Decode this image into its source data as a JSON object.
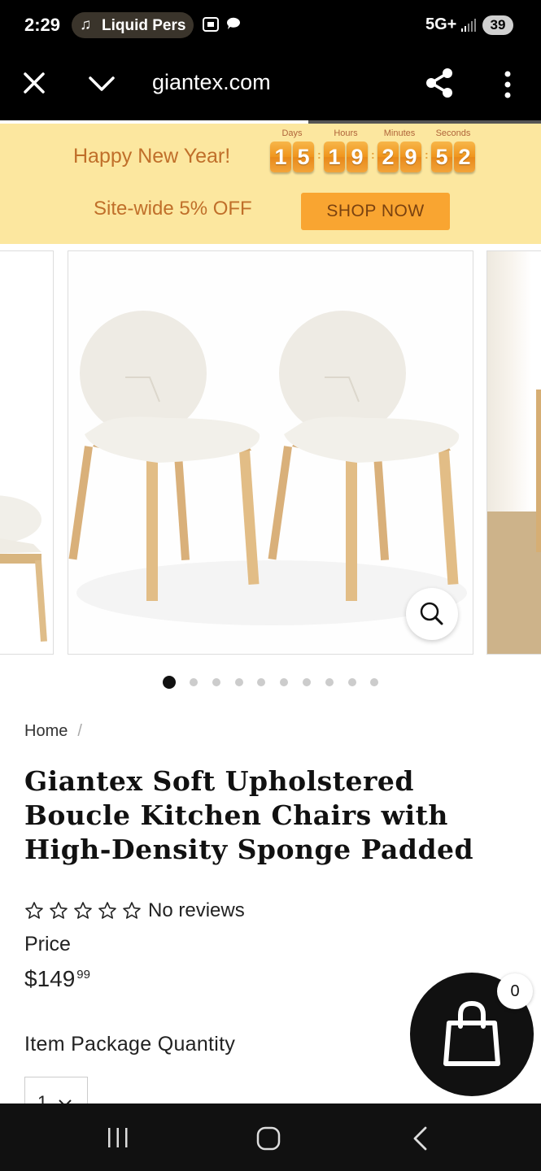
{
  "status_bar": {
    "time": "2:29",
    "media_label": "Liquid Pers",
    "network": "5G+",
    "battery": "39"
  },
  "browser": {
    "url": "giantex.com",
    "load_progress": 0.57
  },
  "promo": {
    "title": "Happy New Year!",
    "countdown": [
      {
        "label": "Days",
        "digits": [
          "1",
          "5"
        ]
      },
      {
        "label": "Hours",
        "digits": [
          "1",
          "9"
        ]
      },
      {
        "label": "Minutes",
        "digits": [
          "2",
          "9"
        ]
      },
      {
        "label": "Seconds",
        "digits": [
          "5",
          "2"
        ]
      }
    ],
    "subtitle": "Site-wide 5% OFF",
    "cta": "SHOP NOW",
    "colors": {
      "background": "#fce79f",
      "text": "#c06f2a",
      "button": "#f9a531"
    }
  },
  "gallery": {
    "dot_count": 10,
    "active_index": 0
  },
  "product": {
    "breadcrumb_home": "Home",
    "breadcrumb_sep": "/",
    "title": "Giantex Soft Upholstered Boucle Kitchen Chairs with High-Density Sponge Padded",
    "rating_stars": 0,
    "reviews_text": "No reviews",
    "price_label": "Price",
    "price_whole": "$149",
    "price_cents": "99",
    "quantity_label": "Item Package Quantity",
    "quantity_value": "1"
  },
  "cart": {
    "count": "0"
  },
  "icons": {
    "close": "close-icon",
    "chevron": "chevron-down-icon",
    "share": "share-icon",
    "more": "more-vertical-icon",
    "zoom": "magnifier-icon",
    "cart": "shopping-bag-icon"
  }
}
